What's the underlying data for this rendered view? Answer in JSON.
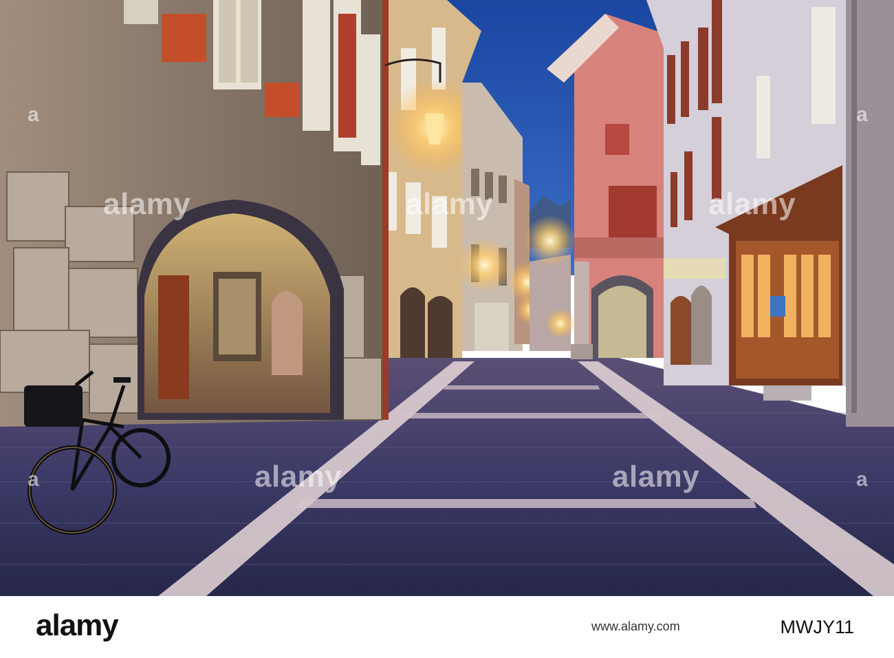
{
  "image": {
    "description_colors": {
      "sky": "#1f4fa6",
      "wall_left": "#8d7b6c",
      "pink_building": "#d4827a",
      "street": "#3a3862",
      "lamp_glow": "#ffd987"
    }
  },
  "watermarks": {
    "text": "alamy",
    "image_id_prefix": "a"
  },
  "footer": {
    "logo": "alamy",
    "url": "www.alamy.com",
    "image_id": "MWJY11"
  }
}
